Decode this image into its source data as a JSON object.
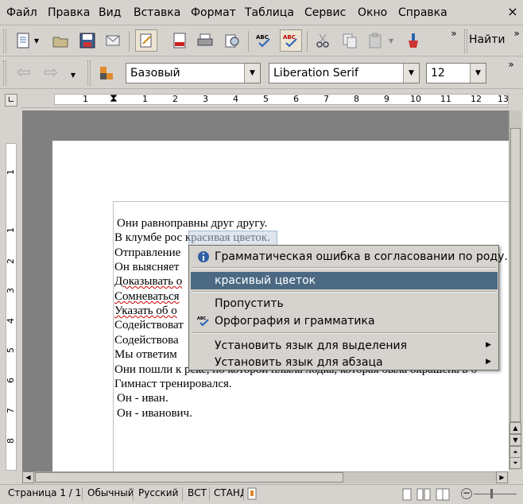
{
  "menubar": {
    "items": [
      "Файл",
      "Правка",
      "Вид",
      "Вставка",
      "Формат",
      "Таблица",
      "Сервис",
      "Окно",
      "Справка"
    ],
    "close": "×"
  },
  "toolbar": {
    "find_label": "Найти",
    "overflow": "»"
  },
  "format_toolbar": {
    "style_value": "Базовый",
    "font_value": "Liberation Serif",
    "size_value": "12"
  },
  "ruler": {
    "h_labels": [
      "1",
      "1",
      "2",
      "3",
      "4",
      "5",
      "6",
      "7",
      "8",
      "9",
      "10",
      "11",
      "12",
      "13"
    ],
    "v_labels": [
      "1",
      "1",
      "2",
      "3",
      "4",
      "5",
      "6",
      "7",
      "8"
    ]
  },
  "document": {
    "lines": [
      "Они равноправны друг другу.",
      "В клумбе рос красивая цветок.",
      "Отправление",
      "Он выясняет",
      "Доказывать о",
      "Сомневаться",
      "Указать об о",
      "Содействоват",
      "Содействова",
      "Мы ответим",
      "Они пошли к реке, по которой плыла лодка, которая была окрашена в б",
      "Гимнаст тренировался.",
      "Он - иван.",
      "Он - иванович."
    ]
  },
  "context_menu": {
    "grammar_note": "Грамматическая ошибка в согласовании по роду.",
    "suggestion": "красивый цветок",
    "skip": "Пропустить",
    "spelling_grammar": "Орфография и грамматика",
    "set_lang_selection": "Установить язык для выделения",
    "set_lang_paragraph": "Установить язык для абзаца"
  },
  "statusbar": {
    "page": "Страница  1 / 1",
    "style": "Обычный",
    "language": "Русский",
    "insert_mode": "ВСТ",
    "selection_mode": "СТАНД"
  },
  "colors": {
    "highlight": "#4b6983",
    "spell_underline": "#d00000",
    "selection": "#c4d1e0"
  }
}
